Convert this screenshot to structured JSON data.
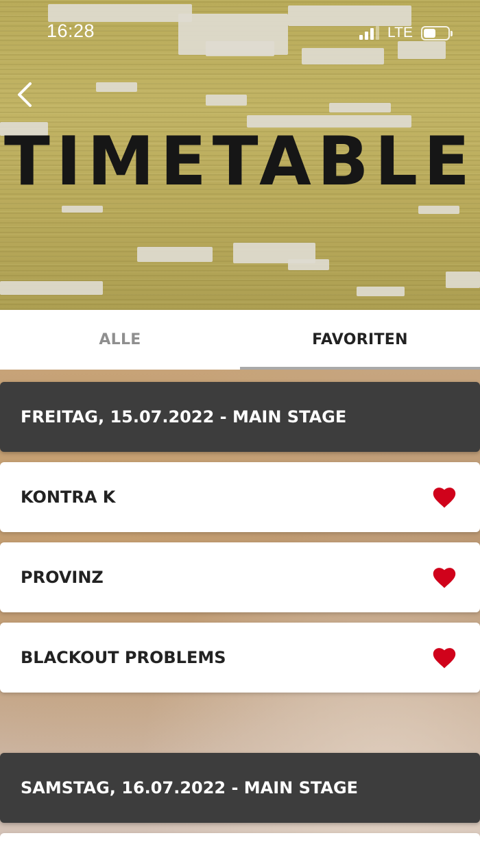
{
  "status_bar": {
    "time": "16:28",
    "network": "LTE",
    "signal_bars": 3,
    "battery_level": 0.5,
    "icon_signal": "cellular-signal-icon",
    "icon_battery": "battery-icon"
  },
  "header": {
    "title": "TIMETABLE",
    "back_icon": "chevron-left-icon"
  },
  "tabs": [
    {
      "label": "ALLE",
      "active": false
    },
    {
      "label": "FAVORITEN",
      "active": true
    }
  ],
  "days": [
    {
      "label": "FREITAG, 15.07.2022 - MAIN STAGE",
      "artists": [
        {
          "name": "KONTRA K",
          "favorite": true
        },
        {
          "name": "PROVINZ",
          "favorite": true
        },
        {
          "name": "BLACKOUT PROBLEMS",
          "favorite": true
        }
      ]
    },
    {
      "label": "SAMSTAG, 16.07.2022 - MAIN STAGE",
      "artists": []
    }
  ],
  "colors": {
    "heart": "#d0021b",
    "day_header_bg": "#3d3d3d",
    "tab_active_text": "#222222",
    "tab_inactive_text": "#8f8f8f"
  }
}
